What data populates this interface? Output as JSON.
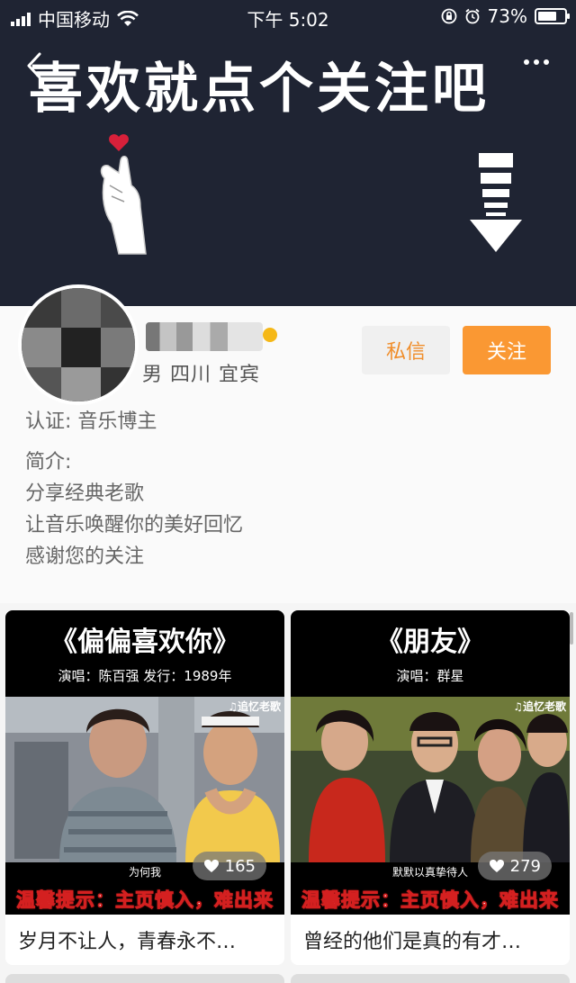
{
  "status_bar": {
    "carrier": "中国移动",
    "time": "下午 5:02",
    "battery": "73%",
    "battery_level": 0.73
  },
  "banner": {
    "title": "喜欢就点个关注吧"
  },
  "profile": {
    "meta": "男  四川 宜宾",
    "message_button": "私信",
    "follow_button": "关注",
    "certification": "认证: 音乐博主",
    "intro_label": "简介:",
    "intro_lines": [
      "分享经典老歌",
      "让音乐唤醒你的美好回忆",
      "感谢您的关注"
    ]
  },
  "videos": [
    {
      "title": "《偏偏喜欢你》",
      "subtitle": "演唱：陈百强   发行：1989年",
      "watermark": "♫追忆老歌",
      "caption": "为何我",
      "tip": "温馨提示：主页慎入，难出来",
      "likes": "165",
      "text": "岁月不让人，青春永不…"
    },
    {
      "title": "《朋友》",
      "subtitle": "演唱：群星",
      "watermark": "♫追忆老歌",
      "caption": "默默以真挚待人",
      "tip": "温馨提示：主页慎入，难出来",
      "likes": "279",
      "text": "曾经的他们是真的有才…"
    }
  ],
  "colors": {
    "banner_bg": "#1f2433",
    "accent": "#fa9833",
    "accent_text": "#f08d2a"
  }
}
